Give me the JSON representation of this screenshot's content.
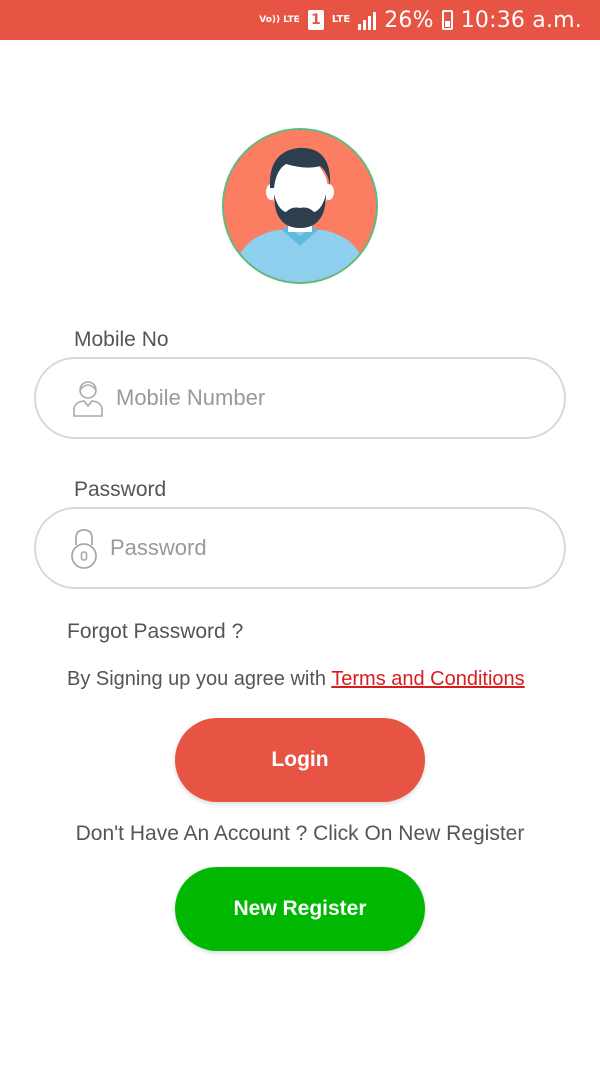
{
  "status_bar": {
    "volte": "Vo)) LTE",
    "sim": "1",
    "lte": "LTE",
    "battery": "26%",
    "time": "10:36 a.m."
  },
  "form": {
    "mobile_label": "Mobile No",
    "mobile_placeholder": "Mobile Number",
    "password_label": "Password",
    "password_placeholder": "Password",
    "forgot": "Forgot Password ?",
    "agree_prefix": "By Signing up you agree with ",
    "terms": "Terms and Conditions",
    "login": "Login",
    "no_account": "Don't Have An Account ? Click On New Register",
    "register": "New Register"
  },
  "colors": {
    "accent": "#e85444",
    "register": "#00b802",
    "link": "#d71d1d"
  }
}
